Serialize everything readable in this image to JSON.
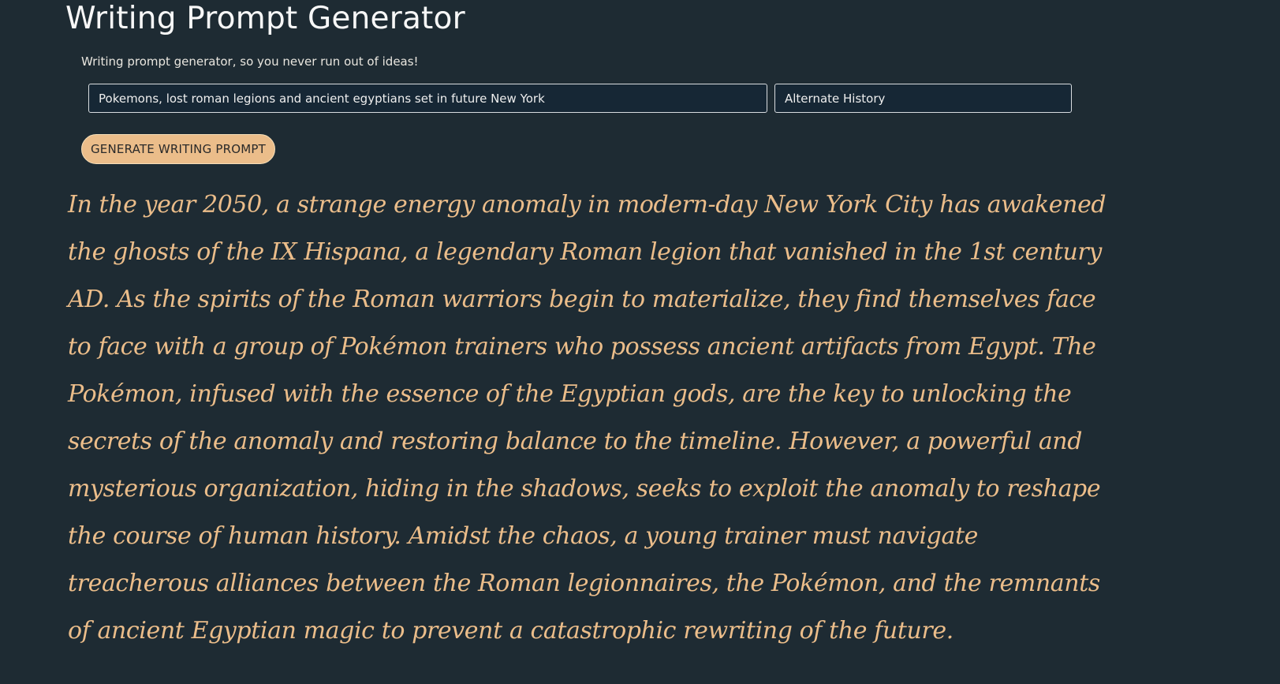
{
  "header": {
    "title": "Writing Prompt Generator",
    "subtitle": "Writing prompt generator, so you never run out of ideas!"
  },
  "form": {
    "topic_value": "Pokemons, lost roman legions and ancient egyptians set in future New York",
    "genre_value": "Alternate History",
    "generate_label": "GENERATE WRITING PROMPT"
  },
  "output": {
    "prompt_text": "In the year 2050, a strange energy anomaly in modern-day New York City has awakened the ghosts of the IX Hispana, a legendary Roman legion that vanished in the 1st century AD. As the spirits of the Roman warriors begin to materialize, they find themselves face to face with a group of Pokémon trainers who possess ancient artifacts from Egypt. The Pokémon, infused with the essence of the Egyptian gods, are the key to unlocking the secrets of the anomaly and restoring balance to the timeline. However, a powerful and mysterious organization, hiding in the shadows, seeks to exploit the anomaly to reshape the course of human history. Amidst the chaos, a young trainer must navigate treacherous alliances between the Roman legionnaires, the Pokémon, and the remnants of ancient Egyptian magic to prevent a catastrophic rewriting of the future."
  },
  "colors": {
    "background": "#1e2b33",
    "accent": "#ebbd8a",
    "input_background": "#162735"
  }
}
